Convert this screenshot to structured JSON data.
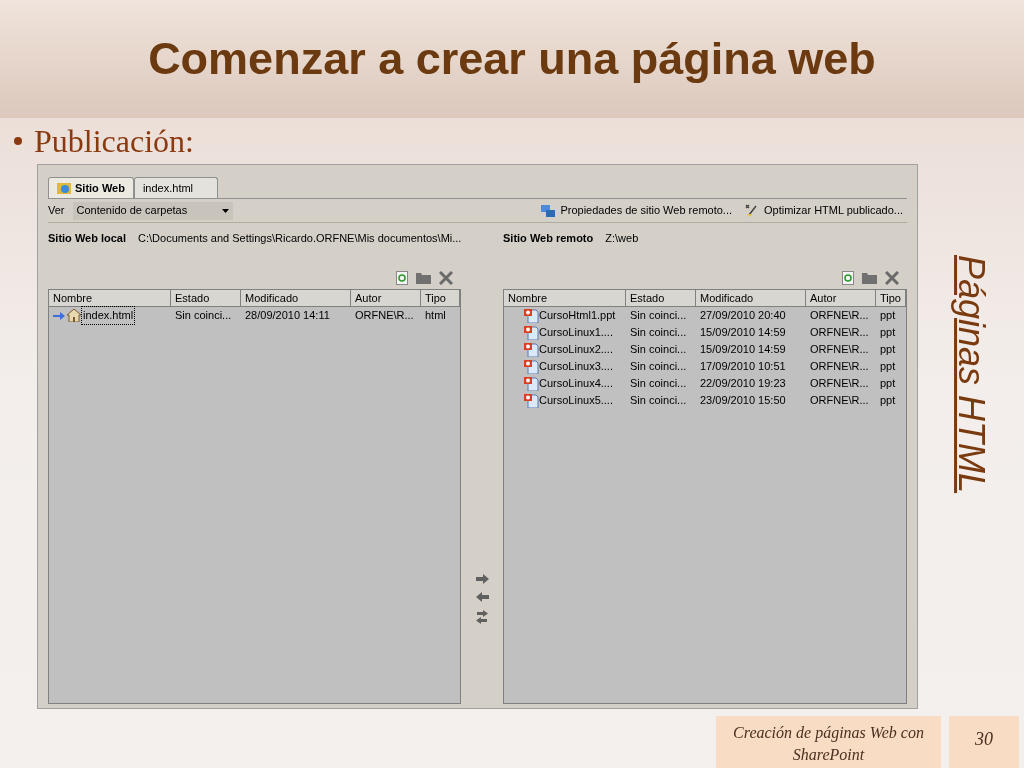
{
  "slide": {
    "title": "Comenzar a crear una página web",
    "bullet": "Publicación:",
    "side_title": "Páginas HTML",
    "footer": "Creación de páginas Web con SharePoint",
    "page_number": "30"
  },
  "window": {
    "tabs": [
      {
        "label": "Sitio Web",
        "selected": true,
        "kind": "site"
      },
      {
        "label": "index.html",
        "selected": false,
        "kind": "file"
      }
    ],
    "view_label": "Ver",
    "view_value": "Contenido de carpetas",
    "actions": [
      {
        "label": "Propiedades de sitio Web remoto...",
        "kind": "properties"
      },
      {
        "label": "Optimizar HTML publicado...",
        "kind": "optimize"
      }
    ],
    "local": {
      "label": "Sitio Web local",
      "columns": [
        "Nombre",
        "Estado",
        "Modificado",
        "Autor",
        "Tipo"
      ],
      "path": "C:\\Documents and Settings\\Ricardo.ORFNE\\Mis documentos\\Mi...",
      "rows": [
        {
          "kind": "home",
          "name": "index.html",
          "estado": "Sin coinci...",
          "modificado": "28/09/2010 14:11",
          "autor": "ORFNE\\R...",
          "tipo": "html",
          "focused": true
        }
      ]
    },
    "remote": {
      "label": "Sitio Web remoto",
      "columns": [
        "Nombre",
        "Estado",
        "Modificado",
        "Autor",
        "Tipo"
      ],
      "path": "Z:\\web",
      "rows": [
        {
          "kind": "ppt",
          "name": "CursoHtml1.ppt",
          "estado": "Sin coinci...",
          "modificado": "27/09/2010 20:40",
          "autor": "ORFNE\\R...",
          "tipo": "ppt",
          "focused": false
        },
        {
          "kind": "ppt",
          "name": "CursoLinux1....",
          "estado": "Sin coinci...",
          "modificado": "15/09/2010 14:59",
          "autor": "ORFNE\\R...",
          "tipo": "ppt",
          "focused": false
        },
        {
          "kind": "ppt",
          "name": "CursoLinux2....",
          "estado": "Sin coinci...",
          "modificado": "15/09/2010 14:59",
          "autor": "ORFNE\\R...",
          "tipo": "ppt",
          "focused": false
        },
        {
          "kind": "ppt",
          "name": "CursoLinux3....",
          "estado": "Sin coinci...",
          "modificado": "17/09/2010 10:51",
          "autor": "ORFNE\\R...",
          "tipo": "ppt",
          "focused": false
        },
        {
          "kind": "ppt",
          "name": "CursoLinux4....",
          "estado": "Sin coinci...",
          "modificado": "22/09/2010 19:23",
          "autor": "ORFNE\\R...",
          "tipo": "ppt",
          "focused": false
        },
        {
          "kind": "ppt",
          "name": "CursoLinux5....",
          "estado": "Sin coinci...",
          "modificado": "23/09/2010 15:50",
          "autor": "ORFNE\\R...",
          "tipo": "ppt",
          "focused": false
        }
      ]
    }
  }
}
